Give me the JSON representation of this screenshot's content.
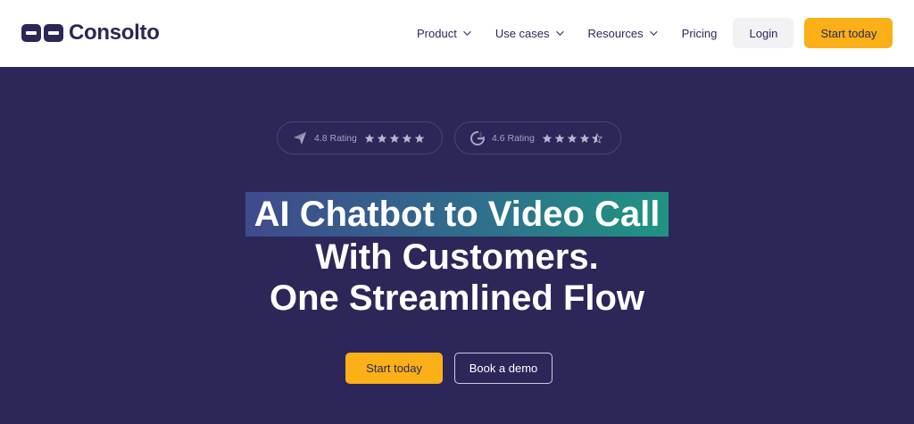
{
  "header": {
    "logo_text": "Consolto",
    "nav": [
      {
        "label": "Product",
        "has_dropdown": true
      },
      {
        "label": "Use cases",
        "has_dropdown": true
      },
      {
        "label": "Resources",
        "has_dropdown": true
      },
      {
        "label": "Pricing",
        "has_dropdown": false
      }
    ],
    "login_label": "Login",
    "start_label": "Start today"
  },
  "hero": {
    "ratings": [
      {
        "icon": "capterra-icon",
        "label": "4.8 Rating",
        "stars": 5
      },
      {
        "icon": "g2-icon",
        "label": "4.6 Rating",
        "stars": 4.5
      }
    ],
    "headline": {
      "line1": "AI Chatbot to Video Call",
      "line2": "With Customers.",
      "line3": "One Streamlined Flow"
    },
    "cta_primary": "Start today",
    "cta_secondary": "Book a demo"
  },
  "colors": {
    "brand_navy": "#2d2658",
    "accent_yellow": "#fbb017",
    "highlight_start": "#3f4a8c",
    "highlight_end": "#1f9482"
  }
}
